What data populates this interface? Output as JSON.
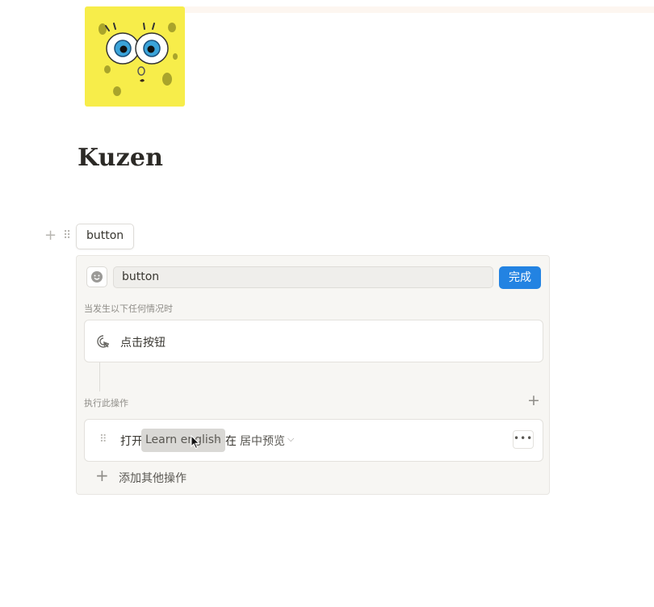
{
  "page": {
    "title": "Kuzen",
    "icon": "spongebob-face-icon"
  },
  "button_block": {
    "label": "button"
  },
  "editor": {
    "emoji_icon": "smiley-face-icon",
    "name_value": "button",
    "done_label": "完成",
    "trigger_section_label": "当发生以下任何情况时",
    "trigger": {
      "icon": "click-pointer-icon",
      "text": "点击按钮"
    },
    "action_section_label": "执行此操作",
    "action": {
      "verb": "打开",
      "page_name": "Learn english",
      "in_word": "在",
      "mode": "居中预览",
      "more_label": "•••"
    },
    "add_action_label": "添加其他操作"
  },
  "colors": {
    "accent": "#2383e2",
    "icon_background": "#f7ed4a"
  }
}
